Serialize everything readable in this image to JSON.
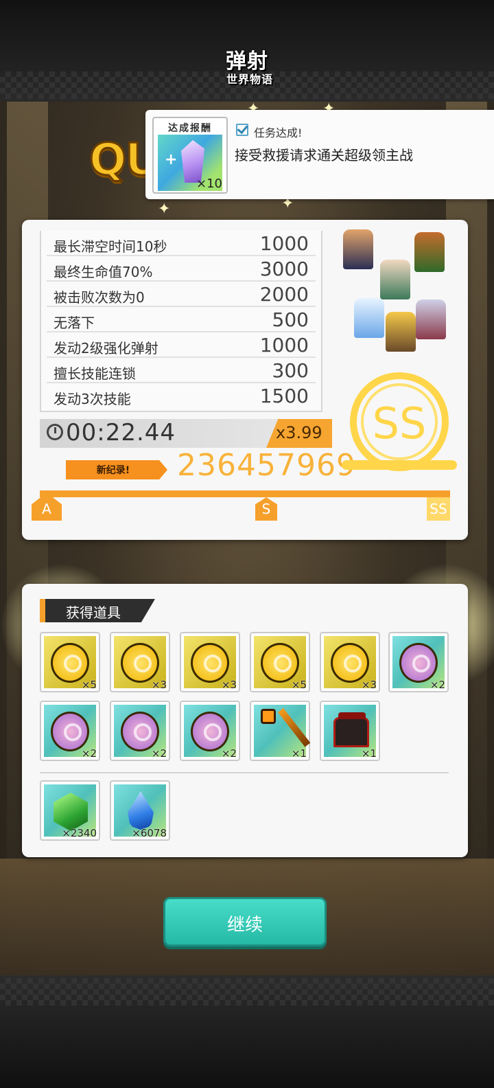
{
  "header": {
    "logo_text": "弹射",
    "logo_sub": "世界物语"
  },
  "quest_title": "QU",
  "toast": {
    "reward_label": "达成报酬",
    "reward_qty": "×10",
    "status": "任务达成!",
    "mission": "接受救援请求通关超级领主战"
  },
  "result": {
    "bonuses": [
      {
        "label": "最长滞空时间10秒",
        "value": "1000"
      },
      {
        "label": "最终生命值70%",
        "value": "3000"
      },
      {
        "label": "被击败次数为0",
        "value": "2000"
      },
      {
        "label": "无落下",
        "value": "500"
      },
      {
        "label": "发动2级强化弹射",
        "value": "1000"
      },
      {
        "label": "擅长技能连锁",
        "value": "300"
      },
      {
        "label": "发动3次技能",
        "value": "1500"
      }
    ],
    "time": "00:22.44",
    "multiplier": "x3.99",
    "new_record_label": "新纪录!",
    "score": "236457969",
    "rank": "SS",
    "progress_fraction": 1.0,
    "rank_markers": [
      "A",
      "S",
      "SS"
    ]
  },
  "items": {
    "header": "获得道具",
    "row1": [
      {
        "icon": "gold-coin-icon",
        "qty": "×5"
      },
      {
        "icon": "gold-coin-icon",
        "qty": "×3"
      },
      {
        "icon": "gold-coin-icon",
        "qty": "×3"
      },
      {
        "icon": "gold-coin-icon",
        "qty": "×5"
      },
      {
        "icon": "gold-coin-icon",
        "qty": "×3"
      },
      {
        "icon": "purple-coin-icon",
        "qty": "×2"
      }
    ],
    "row2": [
      {
        "icon": "purple-coin-icon",
        "qty": "×2"
      },
      {
        "icon": "purple-coin-icon",
        "qty": "×2"
      },
      {
        "icon": "purple-coin-icon",
        "qty": "×2"
      },
      {
        "icon": "staff-icon",
        "qty": "×1"
      },
      {
        "icon": "gauntlet-icon",
        "qty": "×1"
      }
    ],
    "row3": [
      {
        "icon": "green-gem-icon",
        "qty": "×2340"
      },
      {
        "icon": "blue-flame-icon",
        "qty": "×6078"
      }
    ]
  },
  "continue_label": "继续",
  "colors": {
    "accent_orange": "#f6a02c",
    "rank_gold": "#ffd54a",
    "button_teal": "#25b9a6"
  }
}
